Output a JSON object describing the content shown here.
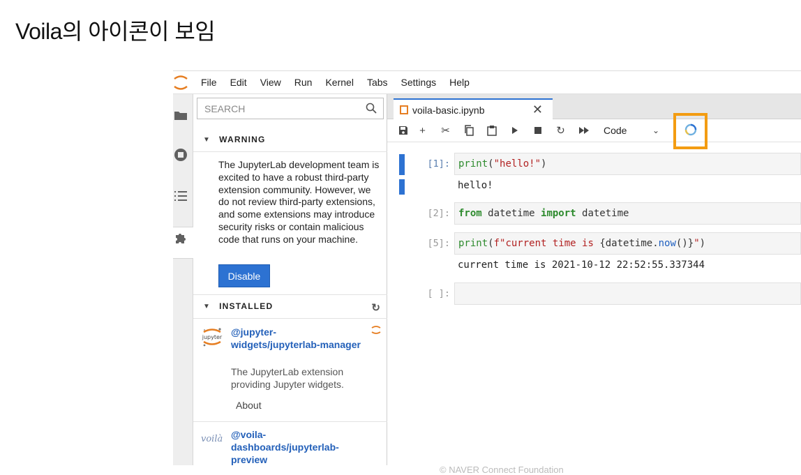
{
  "slide": {
    "title": "Voila의 아이콘이 보임",
    "footer": "© NAVER Connect Foundation"
  },
  "menubar": {
    "items": [
      "File",
      "Edit",
      "View",
      "Run",
      "Kernel",
      "Tabs",
      "Settings",
      "Help"
    ]
  },
  "panel": {
    "search_placeholder": "SEARCH",
    "warning": {
      "header": "WARNING",
      "text": "The JupyterLab development team is excited to have a robust third-party extension community. However, we do not review third-party extensions, and some extensions may introduce security risks or contain malicious code that runs on your machine.",
      "button": "Disable"
    },
    "installed": {
      "header": "INSTALLED",
      "extensions": [
        {
          "logo": "jupyter",
          "name": "@jupyter-widgets/jupyterlab-manager",
          "desc": "The JupyterLab extension providing Jupyter widgets.",
          "about": "About"
        },
        {
          "logo": "voilà",
          "name": "@voila-dashboards/jupyterlab-preview"
        }
      ]
    }
  },
  "notebook": {
    "tab_title": "voila-basic.ipynb",
    "cell_type": "Code",
    "cells": [
      {
        "prompt": "[1]:",
        "code": "print(\"hello!\")",
        "output": "hello!"
      },
      {
        "prompt": "[2]:",
        "code": "from datetime import datetime",
        "output": ""
      },
      {
        "prompt": "[5]:",
        "code": "print(f\"current time is {datetime.now()}\")",
        "output": "current time is 2021-10-12 22:52:55.337344"
      },
      {
        "prompt": "[ ]:",
        "code": "",
        "output": ""
      }
    ]
  },
  "colors": {
    "accent": "#2d72d2",
    "highlight": "#f39c12",
    "jupyter_orange": "#e67e22"
  }
}
